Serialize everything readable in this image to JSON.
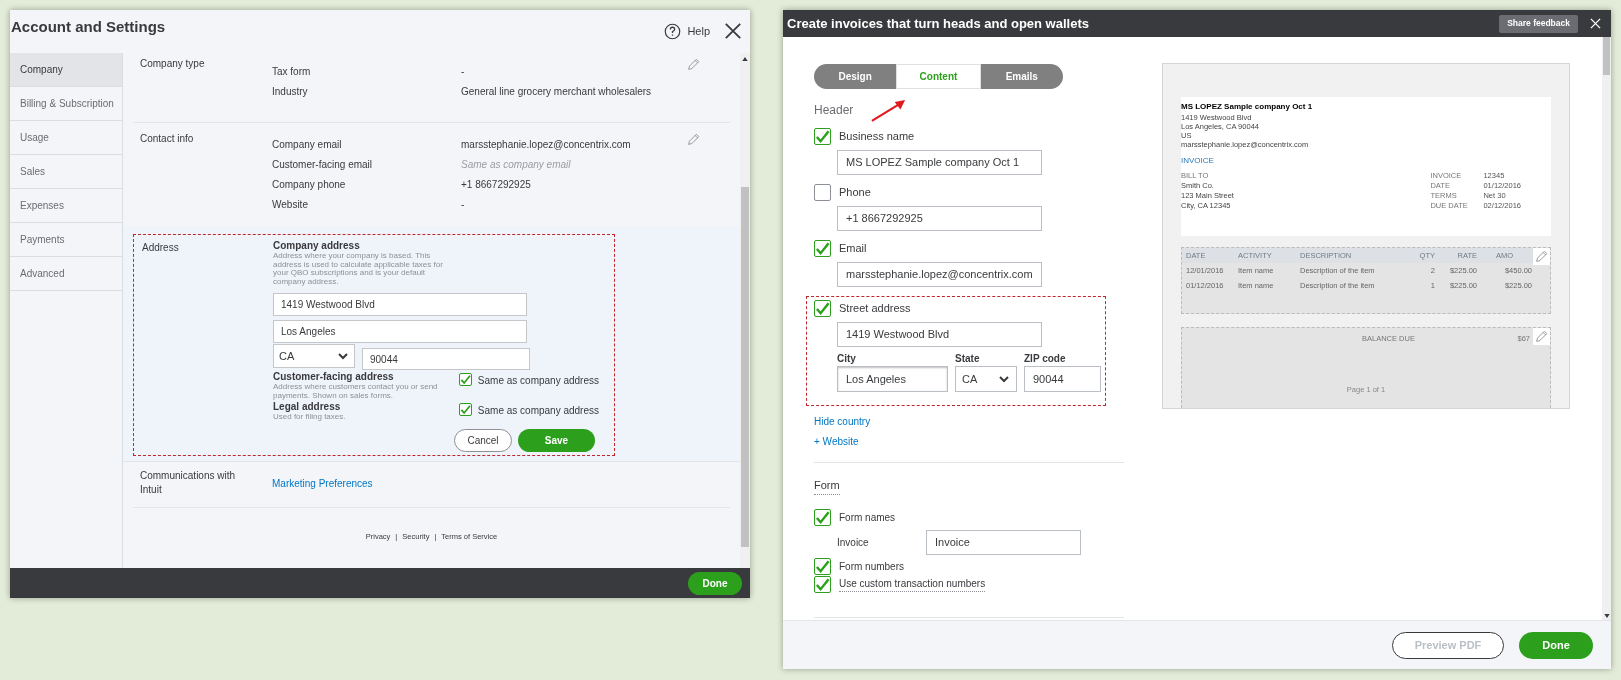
{
  "left": {
    "title": "Account and Settings",
    "help": "Help",
    "sidebar": [
      {
        "label": "Company",
        "selected": true
      },
      {
        "label": "Billing & Subscription",
        "selected": false
      },
      {
        "label": "Usage",
        "selected": false
      },
      {
        "label": "Sales",
        "selected": false
      },
      {
        "label": "Expenses",
        "selected": false
      },
      {
        "label": "Payments",
        "selected": false
      },
      {
        "label": "Advanced",
        "selected": false
      }
    ],
    "company_type": {
      "heading": "Company type",
      "rows": [
        {
          "label": "Tax form",
          "value": "-"
        },
        {
          "label": "Industry",
          "value": "General line grocery merchant wholesalers"
        }
      ]
    },
    "contact_info": {
      "heading": "Contact info",
      "rows": [
        {
          "label": "Company email",
          "value": "marsstephanie.lopez@concentrix.com"
        },
        {
          "label": "Customer-facing email",
          "placeholder": "Same as company email"
        },
        {
          "label": "Company phone",
          "value": "+1 8667292925"
        },
        {
          "label": "Website",
          "value": "-"
        }
      ]
    },
    "address": {
      "heading": "Address",
      "company_title": "Company address",
      "company_description": "Address where your company is based. This address is used to calculate applicable taxes for your QBO subscriptions and is your default company address.",
      "street": "1419 Westwood Blvd",
      "city": "Los Angeles",
      "state": "CA",
      "zip": "90044",
      "others": [
        {
          "title": "Customer-facing address",
          "description": "Address where customers contact you or send payments. Shown on sales forms.",
          "same_label": "Same as company address",
          "checked": true
        },
        {
          "title": "Legal address",
          "description": "Used for filing taxes.",
          "same_label": "Same as company address",
          "checked": true
        }
      ],
      "cancel": "Cancel",
      "save": "Save"
    },
    "communications": {
      "heading": "Communications with Intuit",
      "link": "Marketing Preferences"
    },
    "footer_links": [
      "Privacy",
      "Security",
      "Terms of Service"
    ],
    "separator": "|",
    "done": "Done"
  },
  "right": {
    "title": "Create invoices that turn heads and open wallets",
    "share_feedback": "Share feedback",
    "tabs": [
      {
        "label": "Design",
        "selected": false
      },
      {
        "label": "Content",
        "selected": true
      },
      {
        "label": "Emails",
        "selected": false
      }
    ],
    "header": {
      "title": "Header",
      "fields": [
        {
          "label": "Business name",
          "checked": true,
          "value": "MS LOPEZ Sample company Oct 1"
        },
        {
          "label": "Phone",
          "checked": false,
          "value": "+1 8667292925"
        },
        {
          "label": "Email",
          "checked": true,
          "value": "marsstephanie.lopez@concentrix.com"
        },
        {
          "label": "Street address",
          "checked": true,
          "value": "1419 Westwood Blvd"
        }
      ],
      "city": {
        "label": "City",
        "value": "Los Angeles"
      },
      "state": {
        "label": "State",
        "value": "CA"
      },
      "zip": {
        "label": "ZIP code",
        "value": "90044"
      },
      "links": [
        "Hide country",
        "+ Website"
      ]
    },
    "form": {
      "title": "Form",
      "form_names": {
        "label": "Form names",
        "checked": true
      },
      "invoice_label": "Invoice",
      "invoice_value": "Invoice",
      "form_numbers": {
        "label": "Form numbers",
        "checked": true
      },
      "custom_numbers": {
        "label": "Use custom transaction numbers",
        "checked": true
      }
    },
    "preview": {
      "company": "MS LOPEZ Sample company Oct 1",
      "address_lines": [
        "1419 Westwood Blvd",
        "Los Angeles, CA 90044",
        "US",
        "marsstephanie.lopez@concentrix.com"
      ],
      "heading": "INVOICE",
      "bill_to": [
        "BILL TO",
        "Smith Co.",
        "123 Main Street",
        "City, CA 12345"
      ],
      "meta": [
        {
          "label": "INVOICE",
          "value": "12345"
        },
        {
          "label": "DATE",
          "value": "01/12/2016"
        },
        {
          "label": "TERMS",
          "value": "Net 30"
        },
        {
          "label": "DUE DATE",
          "value": "02/12/2016"
        }
      ],
      "columns": [
        "DATE",
        "ACTIVITY",
        "DESCRIPTION",
        "QTY",
        "RATE",
        "AMO"
      ],
      "rows": [
        [
          "12/01/2016",
          "Item name",
          "Description of the item",
          "2",
          "$225.00",
          "$450.00"
        ],
        [
          "01/12/2016",
          "Item name",
          "Description of the item",
          "1",
          "$225.00",
          "$225.00"
        ]
      ],
      "balance_label": "BALANCE DUE",
      "balance_value": "$67",
      "page": "Page 1 of 1"
    },
    "preview_pdf": "Preview PDF",
    "done": "Done"
  }
}
